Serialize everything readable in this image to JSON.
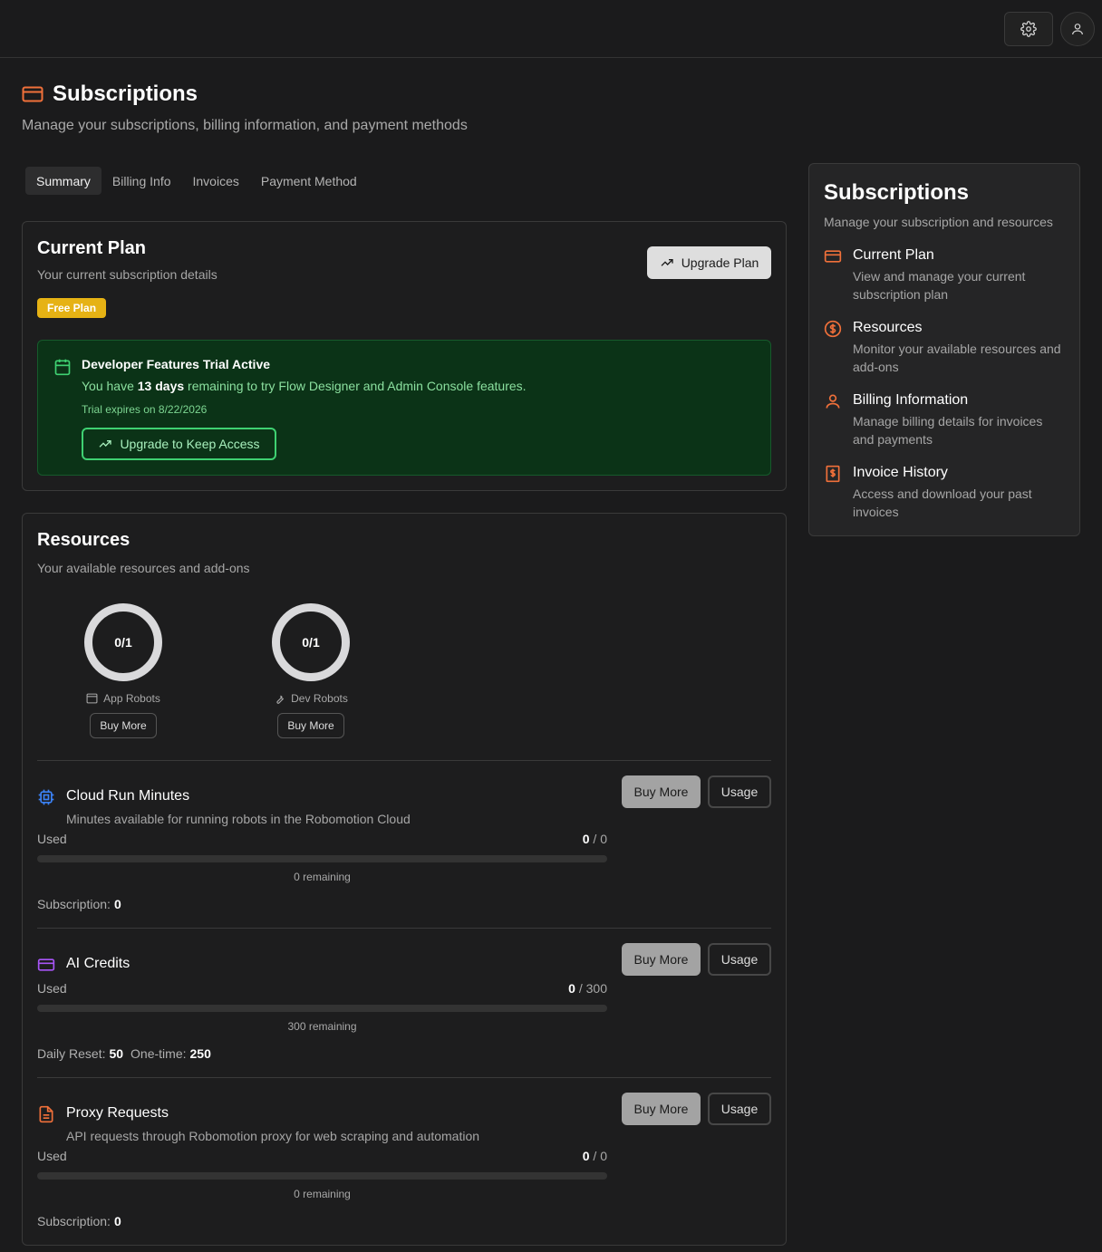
{
  "header": {
    "settings_icon": "gear-icon",
    "user_icon": "user-icon"
  },
  "page": {
    "title": "Subscriptions",
    "subtitle": "Manage your subscriptions, billing information, and payment methods",
    "accent": "#f0703a"
  },
  "tabs": [
    "Summary",
    "Billing Info",
    "Invoices",
    "Payment Method"
  ],
  "current_plan": {
    "title": "Current Plan",
    "subtitle": "Your current subscription details",
    "upgrade_label": "Upgrade Plan",
    "badge": "Free Plan",
    "trial": {
      "title": "Developer Features Trial Active",
      "text_before": "You have ",
      "days": "13 days",
      "text_after": " remaining to try Flow Designer and Admin Console features.",
      "expires": "Trial expires on 8/22/2026",
      "button": "Upgrade to Keep Access"
    }
  },
  "resources": {
    "title": "Resources",
    "subtitle": "Your available resources and add-ons",
    "rings": [
      {
        "value": "0/1",
        "label": "App Robots",
        "button": "Buy More",
        "icon": "window-icon"
      },
      {
        "value": "0/1",
        "label": "Dev Robots",
        "button": "Buy More",
        "icon": "wrench-icon"
      }
    ],
    "items": [
      {
        "title": "Cloud Run Minutes",
        "desc": "Minutes available for running robots in the Robomotion Cloud",
        "buy": "Buy More",
        "usage": "Usage",
        "used_label": "Used",
        "used": "0",
        "total": "0",
        "fill": 0,
        "remaining": "0 remaining",
        "sub_label": "Subscription:",
        "sub_value": "0",
        "icon": "cpu-icon",
        "icon_color": "#3b82f6"
      },
      {
        "title": "AI Credits",
        "desc": "",
        "buy": "Buy More",
        "usage": "Usage",
        "used_label": "Used",
        "used": "0",
        "total": "300",
        "fill": 0,
        "remaining": "300 remaining",
        "daily_label": "Daily Reset:",
        "daily_value": "50",
        "onetime_label": "One-time:",
        "onetime_value": "250",
        "icon": "credit-card-icon",
        "icon_color": "#a855f7"
      },
      {
        "title": "Proxy Requests",
        "desc": "API requests through Robomotion proxy for web scraping and automation",
        "buy": "Buy More",
        "usage": "Usage",
        "used_label": "Used",
        "used": "0",
        "total": "0",
        "fill": 0,
        "remaining": "0 remaining",
        "sub_label": "Subscription:",
        "sub_value": "0",
        "icon": "document-icon",
        "icon_color": "#f0703a"
      }
    ]
  },
  "sidebar": {
    "title": "Subscriptions",
    "subtitle": "Manage your subscription and resources",
    "items": [
      {
        "title": "Current Plan",
        "desc": "View and manage your current subscription plan",
        "icon": "credit-card-icon"
      },
      {
        "title": "Resources",
        "desc": "Monitor your available resources and add-ons",
        "icon": "dollar-circle-icon"
      },
      {
        "title": "Billing Information",
        "desc": "Manage billing details for invoices and payments",
        "icon": "user-icon"
      },
      {
        "title": "Invoice History",
        "desc": "Access and download your past invoices",
        "icon": "receipt-icon"
      }
    ]
  }
}
